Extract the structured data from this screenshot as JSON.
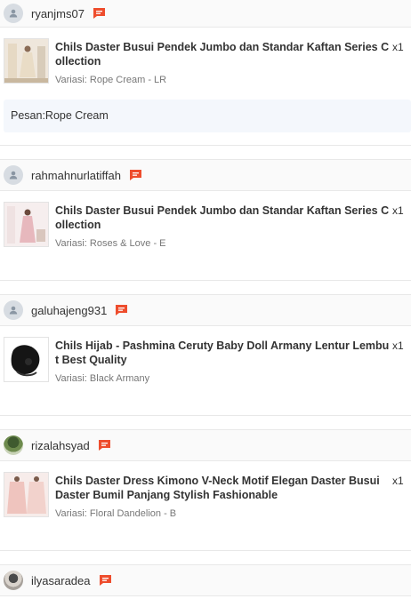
{
  "orders": [
    {
      "username": "ryanjms07",
      "product_name": "Chils Daster Busui Pendek Jumbo dan Standar Kaftan Series Collection",
      "quantity": "x1",
      "variation": "Variasi: Rope Cream - LR",
      "note": "Pesan:Rope Cream"
    },
    {
      "username": "rahmahnurlatiffah",
      "product_name": "Chils Daster Busui Pendek Jumbo dan Standar Kaftan Series Collection",
      "quantity": "x1",
      "variation": "Variasi: Roses & Love - E"
    },
    {
      "username": "galuhajeng931",
      "product_name": "Chils Hijab - Pashmina Ceruty Baby Doll Armany Lentur Lembut Best Quality",
      "quantity": "x1",
      "variation": "Variasi: Black Armany"
    },
    {
      "username": "rizalahsyad",
      "product_name": "Chils Daster Dress Kimono V-Neck Motif Elegan Daster Busui Daster Bumil Panjang Stylish Fashionable",
      "quantity": "x1",
      "variation": "Variasi: Floral Dandelion - B"
    },
    {
      "username": "ilyasaradea"
    }
  ],
  "colors": {
    "chat_icon": "#ee4d2d",
    "note_background": "#f4f7fc",
    "header_background": "#fafafa"
  },
  "icons": {
    "avatar_placeholder": "user-icon",
    "chat": "chat-icon"
  }
}
